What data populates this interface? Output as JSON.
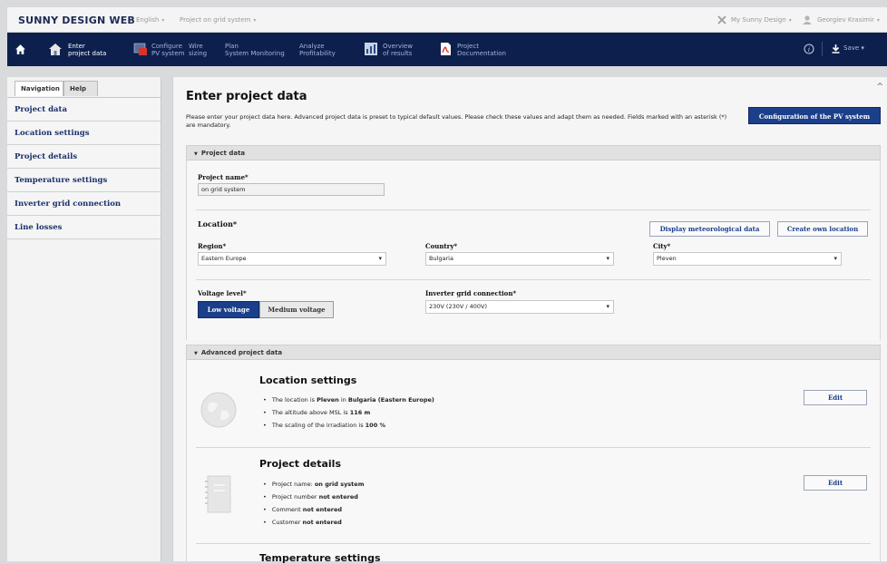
{
  "header": {
    "brand": "SUNNY DESIGN WEB",
    "language": "English",
    "project": "Project on grid system",
    "my_sunny_design": "My Sunny Design",
    "user": "Georgiev Krasimir"
  },
  "nav": {
    "items": [
      {
        "label": "Enter\nproject data",
        "active": true
      },
      {
        "label": "Configure\nPV system"
      },
      {
        "label": "Wire\nsizing"
      },
      {
        "label": "Plan\nSystem Monitoring"
      },
      {
        "label": "Analyze\nProfitability"
      },
      {
        "label": "Overview\nof results"
      },
      {
        "label": "Project\nDocumentation"
      }
    ],
    "info": "i",
    "save": "Save"
  },
  "sidebar": {
    "tabs": [
      "Navigation",
      "Help"
    ],
    "items": [
      "Project data",
      "Location settings",
      "Project details",
      "Temperature settings",
      "Inverter grid connection",
      "Line losses"
    ]
  },
  "main": {
    "title": "Enter project data",
    "intro": "Please enter your project data here. Advanced project data is preset to typical default values. Please check these values and adapt them as needed. Fields marked with an asterisk (*) are mandatory.",
    "config_button": "Configuration of the PV system",
    "project_section": "Project data",
    "project_name_label": "Project name*",
    "project_name_value": "on grid system",
    "location_label": "Location*",
    "display_meteo": "Display meteorological data",
    "create_location": "Create own location",
    "region_label": "Region*",
    "region_value": "Eastern Europe",
    "country_label": "Country*",
    "country_value": "Bulgaria",
    "city_label": "City*",
    "city_value": "Pleven",
    "voltage_label": "Voltage level*",
    "low_voltage": "Low voltage",
    "medium_voltage": "Medium voltage",
    "inverter_label": "Inverter grid connection*",
    "inverter_value": "230V (230V / 400V)",
    "advanced_section": "Advanced project data",
    "location_settings": {
      "title": "Location settings",
      "l1a": "The location is ",
      "l1b": "Pleven",
      "l1c": " in ",
      "l1d": "Bulgaria (Eastern Europe)",
      "l2a": "The altitude above MSL is ",
      "l2b": "116 m",
      "l3a": "The scaling of the irradiation is ",
      "l3b": "100 %",
      "edit": "Edit"
    },
    "project_details": {
      "title": "Project details",
      "l1a": "Project name: ",
      "l1b": "on grid system",
      "l2a": "Project number ",
      "l2b": "not entered",
      "l3a": "Comment ",
      "l3b": "not entered",
      "l4a": "Customer ",
      "l4b": "not entered",
      "edit": "Edit"
    },
    "temperature_settings": {
      "title": "Temperature settings"
    }
  }
}
